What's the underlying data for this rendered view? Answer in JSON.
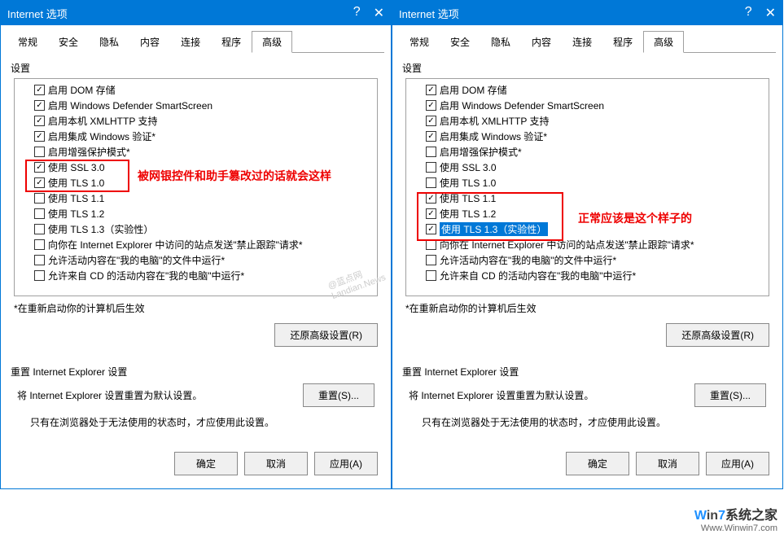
{
  "title": "Internet 选项",
  "tabs": [
    "常规",
    "安全",
    "隐私",
    "内容",
    "连接",
    "程序",
    "高级"
  ],
  "active_tab": "高级",
  "settings_label": "设置",
  "items": [
    {
      "label": "启用 DOM 存储",
      "checked": true
    },
    {
      "label": "启用 Windows Defender SmartScreen",
      "checked": true
    },
    {
      "label": "启用本机 XMLHTTP 支持",
      "checked": true
    },
    {
      "label": "启用集成 Windows 验证*",
      "checked": true
    },
    {
      "label": "启用增强保护模式*",
      "checked": false
    },
    {
      "label": "使用 SSL 3.0",
      "checked": true
    },
    {
      "label": "使用 TLS 1.0",
      "checked": true
    },
    {
      "label": "使用 TLS 1.1",
      "checked": false
    },
    {
      "label": "使用 TLS 1.2",
      "checked": false
    },
    {
      "label": "使用 TLS 1.3（实验性）",
      "checked": false
    },
    {
      "label": "向你在 Internet Explorer 中访问的站点发送\"禁止跟踪\"请求*",
      "checked": false
    },
    {
      "label": "允许活动内容在\"我的电脑\"的文件中运行*",
      "checked": false
    },
    {
      "label": "允许来自 CD 的活动内容在\"我的电脑\"中运行*",
      "checked": false
    }
  ],
  "items_right": [
    {
      "label": "启用 DOM 存储",
      "checked": true
    },
    {
      "label": "启用 Windows Defender SmartScreen",
      "checked": true
    },
    {
      "label": "启用本机 XMLHTTP 支持",
      "checked": true
    },
    {
      "label": "启用集成 Windows 验证*",
      "checked": true
    },
    {
      "label": "启用增强保护模式*",
      "checked": false
    },
    {
      "label": "使用 SSL 3.0",
      "checked": false
    },
    {
      "label": "使用 TLS 1.0",
      "checked": false
    },
    {
      "label": "使用 TLS 1.1",
      "checked": true
    },
    {
      "label": "使用 TLS 1.2",
      "checked": true
    },
    {
      "label": "使用 TLS 1.3（实验性）",
      "checked": true,
      "selected": true
    },
    {
      "label": "向你在 Internet Explorer 中访问的站点发送\"禁止跟踪\"请求*",
      "checked": false
    },
    {
      "label": "允许活动内容在\"我的电脑\"的文件中运行*",
      "checked": false
    },
    {
      "label": "允许来自 CD 的活动内容在\"我的电脑\"中运行*",
      "checked": false
    }
  ],
  "annotation_left": "被网银控件和助手篡改过的话就会这样",
  "annotation_right": "正常应该是这个样子的",
  "restart_note": "*在重新启动你的计算机后生效",
  "restore_btn": "还原高级设置(R)",
  "reset_label": "重置 Internet Explorer 设置",
  "reset_text": "将 Internet Explorer 设置重置为默认设置。",
  "reset_btn": "重置(S)...",
  "reset_note": "只有在浏览器处于无法使用的状态时，才应使用此设置。",
  "ok": "确定",
  "cancel": "取消",
  "apply": "应用(A)",
  "watermark_left": "@蓝点网 Landian.News",
  "logo_line1": "Win7系统之家",
  "logo_w": "W",
  "logo_7": "7",
  "logo_line2": "Www.Winwin7.com"
}
